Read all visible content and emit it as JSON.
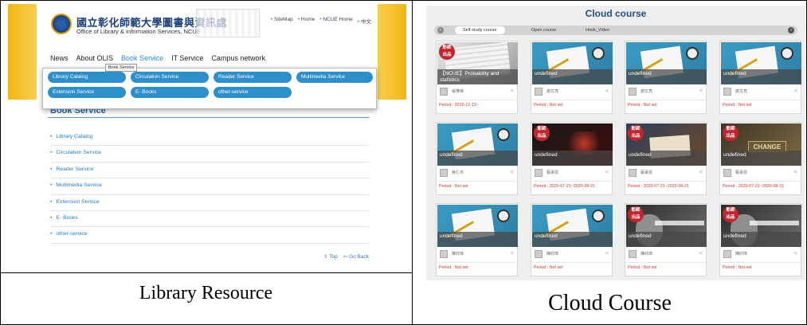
{
  "library": {
    "site_title_zh": "國立彰化師範大學圖書與資訊處",
    "site_title_en": "Office of Library & Information Services, NCUE",
    "top_links": [
      "SiteMap",
      "Home",
      "NCUE Home",
      "中文"
    ],
    "nav": [
      "News",
      "About OLIS",
      "Book Service",
      "IT Service",
      "Campus network"
    ],
    "tooltip": "Book Service",
    "dropdown": [
      "Library Catalog",
      "Circulation Service",
      "Reader Service",
      "Multimedia Service",
      "Extension Service",
      "E- Books",
      "other-service"
    ],
    "section_title": "Book Service",
    "services": [
      "Library Catalog",
      "Circulation Service",
      "Reader Service",
      "Multimedia Service",
      "Extension Service",
      "E- Books",
      "other-service"
    ],
    "footer": {
      "top": "Top",
      "back": "Go Back"
    },
    "caption": "Library Resource"
  },
  "cloud": {
    "title": "Cloud course",
    "tabs": [
      "Self-study course",
      "Open course",
      "Hook_Video"
    ],
    "badge": "彰師\n出品",
    "cards": [
      {
        "thumb": "pencil",
        "badge": true,
        "caption": "【NCUE】Probability and statistics",
        "author": "張惟傑",
        "period": "Period : 2016-12-13~"
      },
      {
        "thumb": "desk",
        "badge": false,
        "caption": "undefined",
        "author": "謝文亮",
        "period": "Period : Not set"
      },
      {
        "thumb": "desk",
        "badge": false,
        "caption": "undefined",
        "author": "謝文亮",
        "period": "Period : Not set"
      },
      {
        "thumb": "desk",
        "badge": false,
        "caption": "undefined",
        "author": "謝文亮",
        "period": "Period : Not set"
      },
      {
        "thumb": "desk",
        "badge": false,
        "caption": "undefined",
        "author": "吳仁杰",
        "period": "Period : Not set"
      },
      {
        "thumb": "dark",
        "badge": true,
        "caption": "undefined",
        "author": "蔡承恩",
        "period": "Period : 2020-07-21~2020-09-21"
      },
      {
        "thumb": "read",
        "badge": true,
        "caption": "undefined",
        "author": "蔡承恩",
        "period": "Period : 2020-07-21~2020-09-21"
      },
      {
        "thumb": "change",
        "badge": true,
        "caption": "undefined",
        "author": "蔡承恩",
        "period": "Period : 2020-07-21~2020-09-21"
      },
      {
        "thumb": "desk",
        "badge": false,
        "caption": "undefined",
        "author": "陳欣瑋",
        "period": "Period : Not set"
      },
      {
        "thumb": "desk",
        "badge": false,
        "caption": "undefined",
        "author": "陳欣瑋",
        "period": "Period : Not set"
      },
      {
        "thumb": "bw",
        "badge": true,
        "caption": "undefined",
        "author": "陳欣瑋",
        "period": "Period : Not set"
      },
      {
        "thumb": "bw",
        "badge": true,
        "caption": "undefined",
        "author": "陳欣瑋",
        "period": "Period : Not set"
      }
    ],
    "caption": "Cloud Course"
  }
}
